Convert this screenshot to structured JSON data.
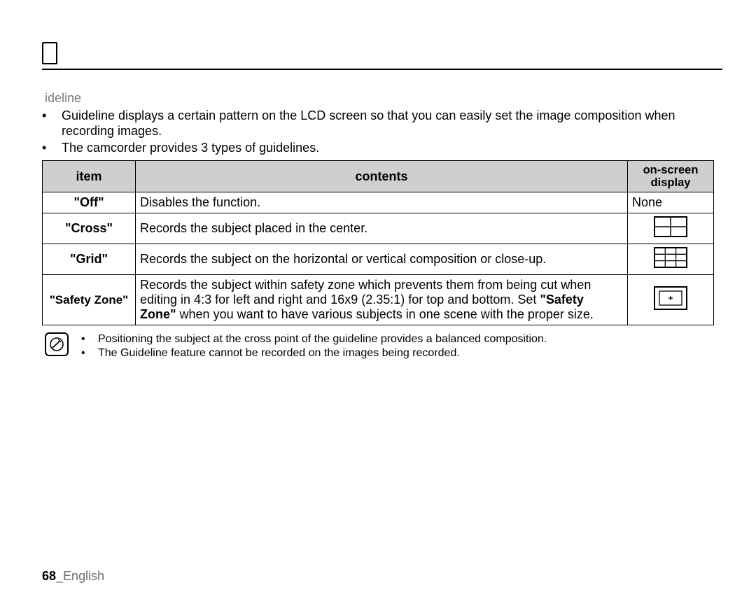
{
  "title_fragment": "ideline",
  "intro": [
    "Guideline displays a certain pattern on the LCD screen so that you can easily set the image composition when recording images.",
    "The camcorder provides 3 types of guidelines."
  ],
  "table": {
    "headers": {
      "item": "item",
      "contents": "contents",
      "display": "on-screen display"
    },
    "rows": [
      {
        "item": "\"Off\"",
        "contents": "Disables the function.",
        "display_text": "None",
        "icon": "none"
      },
      {
        "item": "\"Cross\"",
        "contents": "Records the subject placed in the center.",
        "icon": "cross"
      },
      {
        "item": "\"Grid\"",
        "contents": "Records the subject on the horizontal or vertical composition or close-up.",
        "icon": "grid"
      },
      {
        "item": "\"Safety Zone\"",
        "contents_pre": "Records the subject within safety zone which prevents them from being cut when editing in 4:3 for left and right and 16x9 (2.35:1) for top and bottom. Set ",
        "contents_bold": "\"Safety Zone\"",
        "contents_post": " when you want to have various subjects in one scene with the proper size.",
        "icon": "safety"
      }
    ]
  },
  "notes": [
    "Positioning the subject at the cross point of the guideline provides a balanced composition.",
    "The Guideline feature cannot be recorded on the images being recorded."
  ],
  "footer": {
    "page": "68",
    "sep": "_",
    "lang": "English"
  }
}
